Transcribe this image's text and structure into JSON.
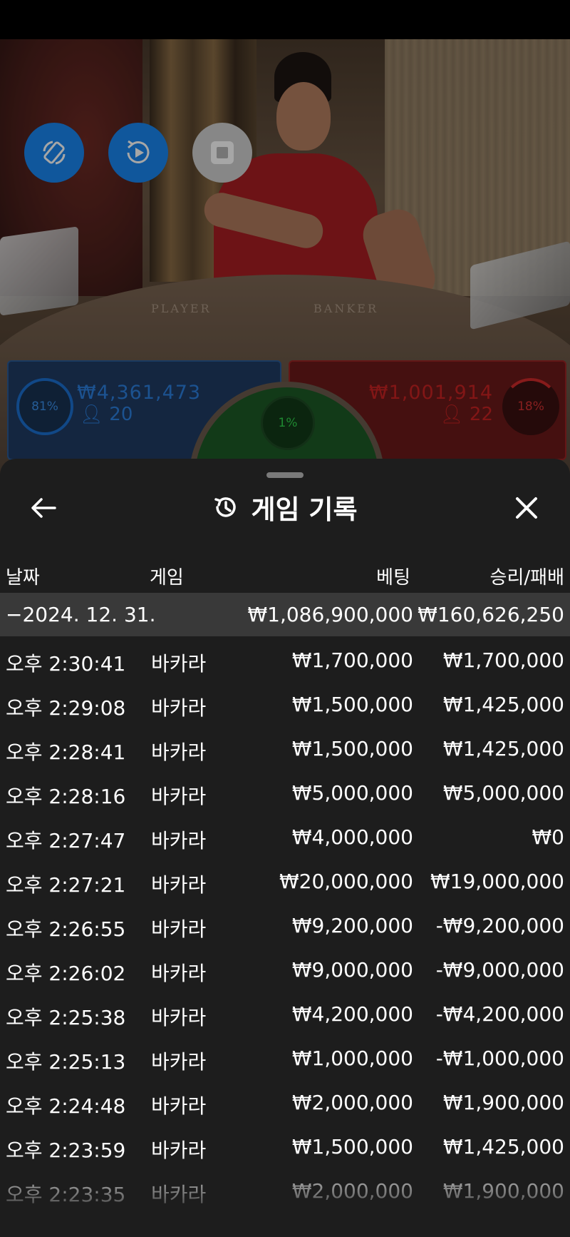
{
  "video": {
    "table_labels": {
      "player": "PLAYER",
      "banker": "BANKER"
    },
    "controls": [
      {
        "name": "rotate-video-button",
        "icon": "rotate-icon"
      },
      {
        "name": "autoplay-button",
        "icon": "replay-play-icon"
      },
      {
        "name": "stop-button",
        "icon": "stop-icon"
      }
    ]
  },
  "betting": {
    "player": {
      "percent": "81%",
      "amount": "₩4,361,473",
      "count": "20",
      "color": "#2b7fdd"
    },
    "tie": {
      "percent": "1%",
      "color": "#2fd14a"
    },
    "banker": {
      "percent": "18%",
      "amount": "₩1,001,914",
      "count": "22",
      "color": "#c82222"
    }
  },
  "sheet": {
    "title": "게임 기록",
    "columns": {
      "date": "날짜",
      "game": "게임",
      "bet": "베팅",
      "result": "승리/패배"
    },
    "summary": {
      "date": "−2024. 12. 31.",
      "bet": "₩1,086,900,000",
      "result": "₩160,626,250"
    },
    "rows": [
      {
        "time": "오후 2:30:41",
        "game": "바카라",
        "bet": "₩1,700,000",
        "result": "₩1,700,000"
      },
      {
        "time": "오후 2:29:08",
        "game": "바카라",
        "bet": "₩1,500,000",
        "result": "₩1,425,000"
      },
      {
        "time": "오후 2:28:41",
        "game": "바카라",
        "bet": "₩1,500,000",
        "result": "₩1,425,000"
      },
      {
        "time": "오후 2:28:16",
        "game": "바카라",
        "bet": "₩5,000,000",
        "result": "₩5,000,000"
      },
      {
        "time": "오후 2:27:47",
        "game": "바카라",
        "bet": "₩4,000,000",
        "result": "₩0"
      },
      {
        "time": "오후 2:27:21",
        "game": "바카라",
        "bet": "₩20,000,000",
        "result": "₩19,000,000"
      },
      {
        "time": "오후 2:26:55",
        "game": "바카라",
        "bet": "₩9,200,000",
        "result": "-₩9,200,000"
      },
      {
        "time": "오후 2:26:02",
        "game": "바카라",
        "bet": "₩9,000,000",
        "result": "-₩9,000,000"
      },
      {
        "time": "오후 2:25:38",
        "game": "바카라",
        "bet": "₩4,200,000",
        "result": "-₩4,200,000"
      },
      {
        "time": "오후 2:25:13",
        "game": "바카라",
        "bet": "₩1,000,000",
        "result": "-₩1,000,000"
      },
      {
        "time": "오후 2:24:48",
        "game": "바카라",
        "bet": "₩2,000,000",
        "result": "₩1,900,000"
      },
      {
        "time": "오후 2:23:59",
        "game": "바카라",
        "bet": "₩1,500,000",
        "result": "₩1,425,000"
      },
      {
        "time": "오후 2:23:35",
        "game": "바카라",
        "bet": "₩2,000,000",
        "result": "₩1,900,000"
      }
    ]
  }
}
